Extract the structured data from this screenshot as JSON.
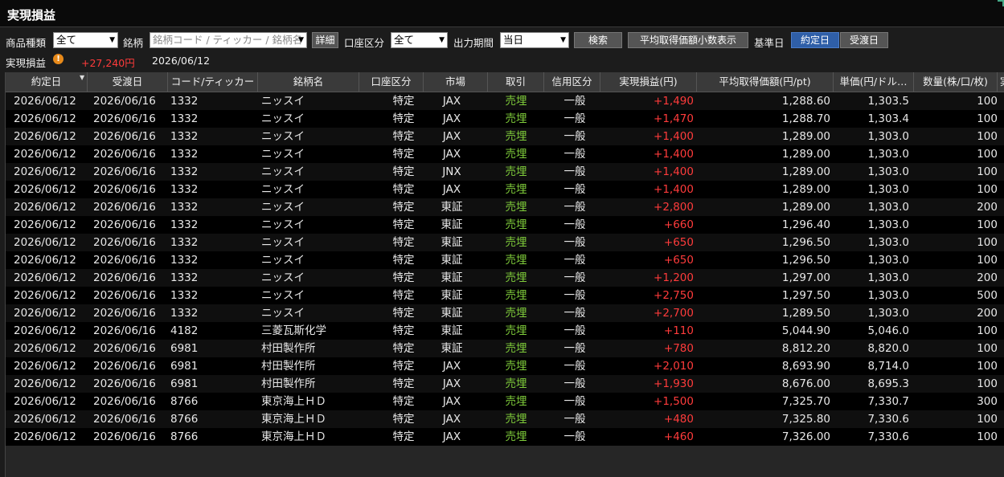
{
  "window": {
    "title": "実現損益"
  },
  "toolbar": {
    "product_label": "商品種類",
    "product_value": "全て",
    "symbol_label": "銘柄",
    "symbol_placeholder": "銘柄コード / ティッカー / 銘柄名",
    "detail_button": "詳細",
    "account_label": "口座区分",
    "account_value": "全て",
    "period_label": "出力期間",
    "period_value": "当日",
    "search_button": "検索",
    "avg_decimal_button": "平均取得価額小数表示",
    "base_date_label": "基準日",
    "trade_date_button": "約定日",
    "delivery_date_button": "受渡日"
  },
  "summary": {
    "label": "実現損益",
    "warn_icon": "!",
    "total": "+27,240円",
    "date": "2026/06/12"
  },
  "table": {
    "columns": [
      "約定日",
      "受渡日",
      "コード/ティッカー",
      "銘柄名",
      "口座区分",
      "市場",
      "取引",
      "信用区分",
      "実現損益(円)",
      "平均取得価額(円/pt)",
      "単価(円/ドル…",
      "数量(株/口/枚)",
      "実"
    ],
    "sort_indicator": "▼",
    "rows": [
      [
        "2026/06/12",
        "2026/06/16",
        "1332",
        "ニッスイ",
        "特定",
        "JAX",
        "売埋",
        "一般",
        "+1,490",
        "1,288.60",
        "1,303.5",
        "100"
      ],
      [
        "2026/06/12",
        "2026/06/16",
        "1332",
        "ニッスイ",
        "特定",
        "JAX",
        "売埋",
        "一般",
        "+1,470",
        "1,288.70",
        "1,303.4",
        "100"
      ],
      [
        "2026/06/12",
        "2026/06/16",
        "1332",
        "ニッスイ",
        "特定",
        "JAX",
        "売埋",
        "一般",
        "+1,400",
        "1,289.00",
        "1,303.0",
        "100"
      ],
      [
        "2026/06/12",
        "2026/06/16",
        "1332",
        "ニッスイ",
        "特定",
        "JAX",
        "売埋",
        "一般",
        "+1,400",
        "1,289.00",
        "1,303.0",
        "100"
      ],
      [
        "2026/06/12",
        "2026/06/16",
        "1332",
        "ニッスイ",
        "特定",
        "JNX",
        "売埋",
        "一般",
        "+1,400",
        "1,289.00",
        "1,303.0",
        "100"
      ],
      [
        "2026/06/12",
        "2026/06/16",
        "1332",
        "ニッスイ",
        "特定",
        "JAX",
        "売埋",
        "一般",
        "+1,400",
        "1,289.00",
        "1,303.0",
        "100"
      ],
      [
        "2026/06/12",
        "2026/06/16",
        "1332",
        "ニッスイ",
        "特定",
        "東証",
        "売埋",
        "一般",
        "+2,800",
        "1,289.00",
        "1,303.0",
        "200"
      ],
      [
        "2026/06/12",
        "2026/06/16",
        "1332",
        "ニッスイ",
        "特定",
        "東証",
        "売埋",
        "一般",
        "+660",
        "1,296.40",
        "1,303.0",
        "100"
      ],
      [
        "2026/06/12",
        "2026/06/16",
        "1332",
        "ニッスイ",
        "特定",
        "東証",
        "売埋",
        "一般",
        "+650",
        "1,296.50",
        "1,303.0",
        "100"
      ],
      [
        "2026/06/12",
        "2026/06/16",
        "1332",
        "ニッスイ",
        "特定",
        "東証",
        "売埋",
        "一般",
        "+650",
        "1,296.50",
        "1,303.0",
        "100"
      ],
      [
        "2026/06/12",
        "2026/06/16",
        "1332",
        "ニッスイ",
        "特定",
        "東証",
        "売埋",
        "一般",
        "+1,200",
        "1,297.00",
        "1,303.0",
        "200"
      ],
      [
        "2026/06/12",
        "2026/06/16",
        "1332",
        "ニッスイ",
        "特定",
        "東証",
        "売埋",
        "一般",
        "+2,750",
        "1,297.50",
        "1,303.0",
        "500"
      ],
      [
        "2026/06/12",
        "2026/06/16",
        "1332",
        "ニッスイ",
        "特定",
        "東証",
        "売埋",
        "一般",
        "+2,700",
        "1,289.50",
        "1,303.0",
        "200"
      ],
      [
        "2026/06/12",
        "2026/06/16",
        "4182",
        "三菱瓦斯化学",
        "特定",
        "東証",
        "売埋",
        "一般",
        "+110",
        "5,044.90",
        "5,046.0",
        "100"
      ],
      [
        "2026/06/12",
        "2026/06/16",
        "6981",
        "村田製作所",
        "特定",
        "東証",
        "売埋",
        "一般",
        "+780",
        "8,812.20",
        "8,820.0",
        "100"
      ],
      [
        "2026/06/12",
        "2026/06/16",
        "6981",
        "村田製作所",
        "特定",
        "JAX",
        "売埋",
        "一般",
        "+2,010",
        "8,693.90",
        "8,714.0",
        "100"
      ],
      [
        "2026/06/12",
        "2026/06/16",
        "6981",
        "村田製作所",
        "特定",
        "JAX",
        "売埋",
        "一般",
        "+1,930",
        "8,676.00",
        "8,695.3",
        "100"
      ],
      [
        "2026/06/12",
        "2026/06/16",
        "8766",
        "東京海上ＨＤ",
        "特定",
        "JAX",
        "売埋",
        "一般",
        "+1,500",
        "7,325.70",
        "7,330.7",
        "300"
      ],
      [
        "2026/06/12",
        "2026/06/16",
        "8766",
        "東京海上ＨＤ",
        "特定",
        "JAX",
        "売埋",
        "一般",
        "+480",
        "7,325.80",
        "7,330.6",
        "100"
      ],
      [
        "2026/06/12",
        "2026/06/16",
        "8766",
        "東京海上ＨＤ",
        "特定",
        "JAX",
        "売埋",
        "一般",
        "+460",
        "7,326.00",
        "7,330.6",
        "100"
      ]
    ]
  },
  "colors": {
    "profit": "#ff3b3b",
    "trade": "#7fcc3a",
    "active_button": "#2f5fa8"
  }
}
